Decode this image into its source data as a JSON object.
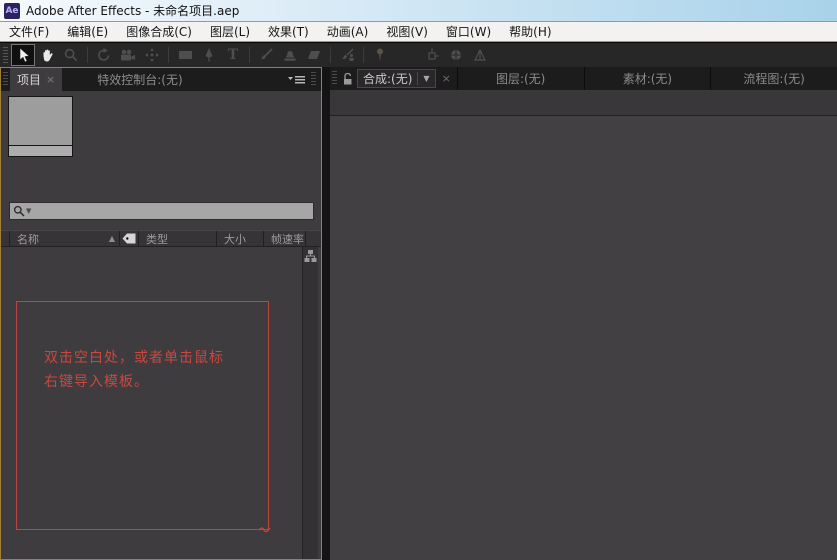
{
  "titlebar": {
    "app_icon_text": "Ae",
    "title": "Adobe After Effects - 未命名项目.aep"
  },
  "menu": {
    "items": [
      "文件(F)",
      "编辑(E)",
      "图像合成(C)",
      "图层(L)",
      "效果(T)",
      "动画(A)",
      "视图(V)",
      "窗口(W)",
      "帮助(H)"
    ]
  },
  "toolbar": {
    "active_tool": "selection-tool",
    "tools": [
      "selection-tool",
      "hand-tool",
      "zoom-tool",
      "rotation-tool",
      "camera-tool",
      "pan-behind-tool",
      "rectangle-mask-tool",
      "pen-tool",
      "type-tool",
      "brush-tool",
      "clone-stamp-tool",
      "eraser-tool",
      "roto-brush-tool",
      "puppet-pin-tool",
      "axis-local-button",
      "axis-world-button",
      "axis-view-button"
    ],
    "type_tool_glyph": "T"
  },
  "project_panel": {
    "tabs": [
      {
        "label": "项目",
        "active": true
      },
      {
        "label": "特效控制台:(无)",
        "active": false
      }
    ],
    "search": {
      "placeholder": ""
    },
    "columns": {
      "name": "名称",
      "type": "类型",
      "size": "大小",
      "frame_rate": "帧速率"
    },
    "hint": {
      "line1": "双击空白处，或者单击鼠标",
      "line2": "右键导入模板。"
    }
  },
  "viewer_panel": {
    "tabs": [
      {
        "label": "合成:(无)",
        "active": true
      },
      {
        "label": "图层:(无)",
        "active": false
      },
      {
        "label": "素材:(无)",
        "active": false
      },
      {
        "label": "流程图:(无)",
        "active": false
      }
    ]
  },
  "ui": {
    "close_glyph": "×",
    "sort_arrow_glyph": "▲",
    "dropdown_glyph": "▼"
  },
  "colors": {
    "focus_border": "#a08136",
    "annotation_red": "#c7493f",
    "panel_bg": "#3f3c40",
    "viewer_bg": "#434044",
    "tabstrip_bg": "#1c1c1c",
    "titlebar_blue": "#a8d2ea"
  }
}
